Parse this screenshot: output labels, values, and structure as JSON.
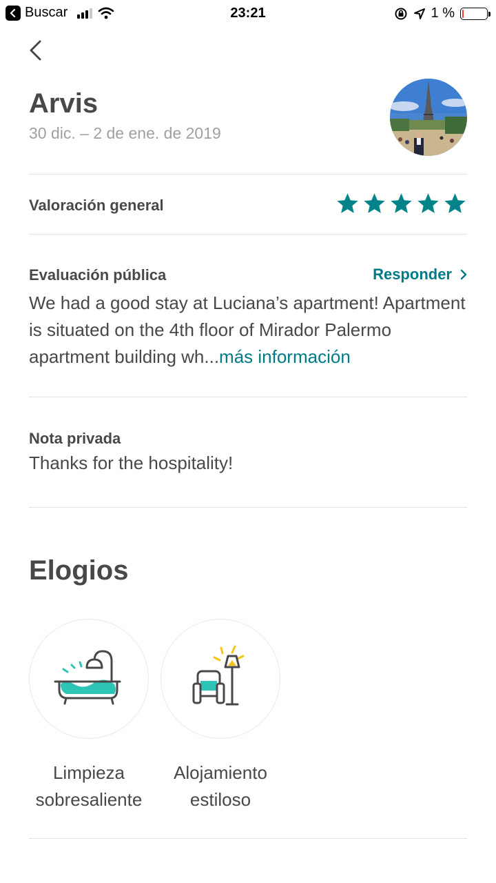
{
  "status_bar": {
    "back_app_label": "Buscar",
    "time": "23:21",
    "battery_pct": "1 %",
    "battery_level": 0.01
  },
  "guest": {
    "name": "Arvis",
    "dates": "30 dic. – 2 de ene. de 2019"
  },
  "overall_rating": {
    "label": "Valoración general",
    "stars": 5,
    "max_stars": 5
  },
  "public_review": {
    "label": "Evaluación pública",
    "reply_label": "Responder",
    "text": "We had a good stay at Luciana’s apartment! Apartment is situated on the 4th floor of Mirador Palermo apartment building wh...",
    "more_label": "más información"
  },
  "private_note": {
    "label": "Nota privada",
    "text": "Thanks for the hospitality!"
  },
  "compliments": {
    "title": "Elogios",
    "items": [
      {
        "label": "Limpieza\nsobresaliente",
        "icon": "bathtub-icon"
      },
      {
        "label": "Alojamiento\nestiloso",
        "icon": "armchair-lamp-icon"
      }
    ]
  },
  "colors": {
    "accent": "#007a87",
    "star": "#008489",
    "badge_teal": "#2ec4b6",
    "badge_yellow": "#f5c518",
    "text": "#484848",
    "muted": "#a0a0a0"
  }
}
